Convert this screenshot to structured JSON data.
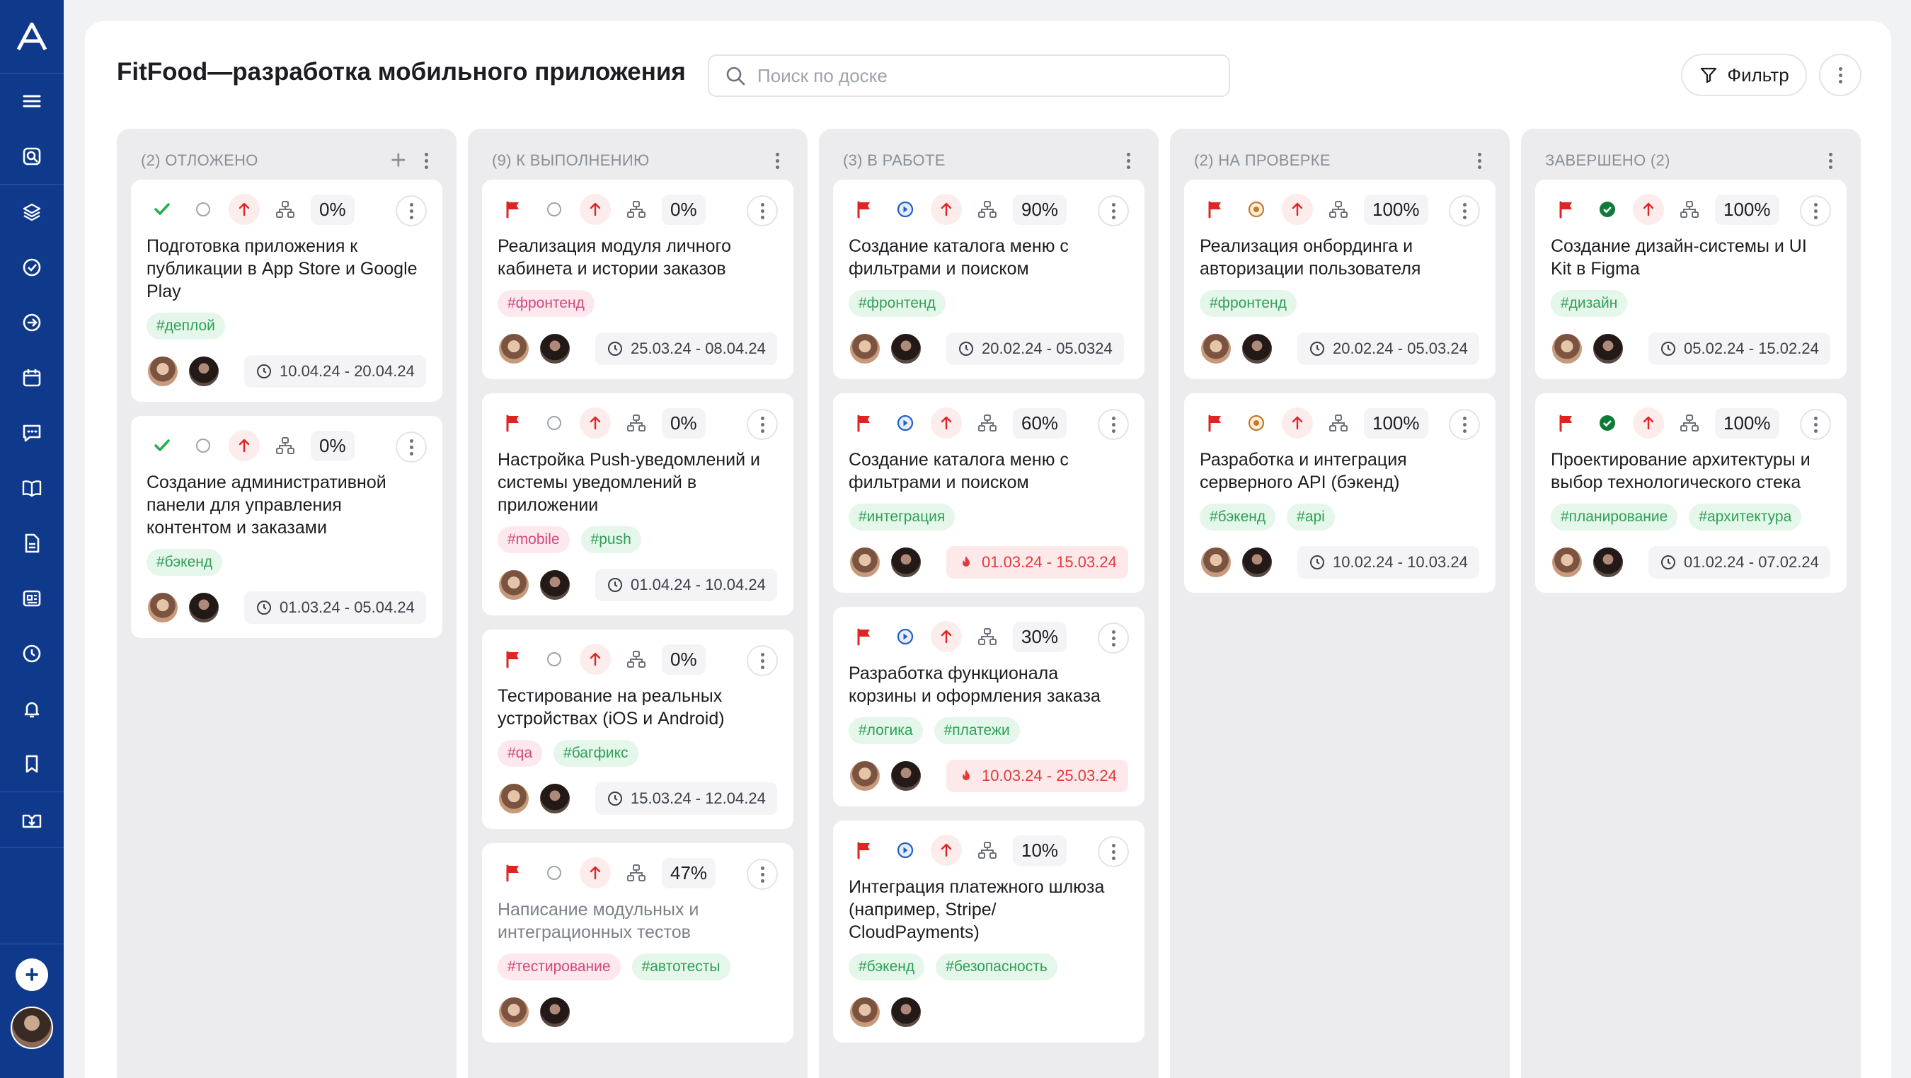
{
  "board": {
    "title": "FitFood—разработка мобильного приложения",
    "search_placeholder": "Поиск по доске",
    "filter_label": "Фильтр"
  },
  "colors": {
    "sidebar": "#0f3a8c",
    "flag": "#e02424",
    "check": "#22b04b",
    "tag_green": "#2fa156",
    "tag_pink": "#d2487a",
    "overdue": "#e03a3a"
  },
  "columns": [
    {
      "title": "(2) ОТЛОЖЕНО",
      "has_add": true,
      "cards": [
        {
          "status_icon": "check-icon",
          "state_icon": "empty-circle-icon",
          "progress": "0%",
          "title": "Подготовка приложения к публикации в App Store и Google Play",
          "tags": [
            {
              "text": "#деплой",
              "color": "green"
            }
          ],
          "dates": "10.04.24 - 20.04.24",
          "overdue": false
        },
        {
          "status_icon": "check-icon",
          "state_icon": "empty-circle-icon",
          "progress": "0%",
          "title": "Создание административной панели для управления контентом и заказами",
          "tags": [
            {
              "text": "#бэкенд",
              "color": "green"
            }
          ],
          "dates": "01.03.24 - 05.04.24",
          "overdue": false
        }
      ]
    },
    {
      "title": "(9) К ВЫПОЛНЕНИЮ",
      "has_add": false,
      "cards": [
        {
          "status_icon": "flag-icon",
          "state_icon": "empty-circle-icon",
          "progress": "0%",
          "title": "Реализация модуля личного кабинета и истории заказов",
          "tags": [
            {
              "text": "#фронтенд",
              "color": "pink"
            }
          ],
          "dates": "25.03.24 - 08.04.24",
          "overdue": false
        },
        {
          "status_icon": "flag-icon",
          "state_icon": "empty-circle-icon",
          "progress": "0%",
          "title": "Настройка Push-уведомлений и системы уведомлений в приложении",
          "tags": [
            {
              "text": "#mobile",
              "color": "pink"
            },
            {
              "text": "#push",
              "color": "green"
            }
          ],
          "dates": "01.04.24 - 10.04.24",
          "overdue": false
        },
        {
          "status_icon": "flag-icon",
          "state_icon": "empty-circle-icon",
          "progress": "0%",
          "title": "Тестирование на реальных устройствах (iOS и Android)",
          "tags": [
            {
              "text": "#qa",
              "color": "pink"
            },
            {
              "text": "#багфикс",
              "color": "green"
            }
          ],
          "dates": "15.03.24 - 12.04.24",
          "overdue": false
        },
        {
          "status_icon": "flag-icon",
          "state_icon": "empty-circle-icon",
          "progress": "47%",
          "title": "Написание модульных и интеграционных тестов",
          "muted": true,
          "tags": [
            {
              "text": "#тестирование",
              "color": "pink"
            },
            {
              "text": "#автотесты",
              "color": "green"
            }
          ],
          "dates": "",
          "overdue": false
        }
      ]
    },
    {
      "title": "(3) В РАБОТЕ",
      "has_add": false,
      "cards": [
        {
          "status_icon": "flag-icon",
          "state_icon": "play-circle-icon",
          "progress": "90%",
          "title": "Создание каталога меню с фильтрами и поиском",
          "tags": [
            {
              "text": "#фронтенд",
              "color": "green"
            }
          ],
          "dates": "20.02.24 - 05.0324",
          "overdue": false
        },
        {
          "status_icon": "flag-icon",
          "state_icon": "play-circle-icon",
          "progress": "60%",
          "title": "Создание каталога меню с фильтрами и поиском",
          "tags": [
            {
              "text": "#интеграция",
              "color": "green"
            }
          ],
          "dates": "01.03.24 - 15.03.24",
          "overdue": true
        },
        {
          "status_icon": "flag-icon",
          "state_icon": "play-circle-icon",
          "progress": "30%",
          "title": "Разработка функционала корзины и оформления заказа",
          "tags": [
            {
              "text": "#логика",
              "color": "green"
            },
            {
              "text": "#платежи",
              "color": "green"
            }
          ],
          "dates": "10.03.24 - 25.03.24",
          "overdue": true
        },
        {
          "status_icon": "flag-icon",
          "state_icon": "play-circle-icon",
          "progress": "10%",
          "title": "Интеграция платежного шлюза (например, Stripe/ CloudPayments)",
          "tags": [
            {
              "text": "#бэкенд",
              "color": "green"
            },
            {
              "text": "#безопасность",
              "color": "green"
            }
          ],
          "dates": "",
          "overdue": false
        }
      ]
    },
    {
      "title": "(2) НА ПРОВЕРКЕ",
      "has_add": false,
      "cards": [
        {
          "status_icon": "flag-icon",
          "state_icon": "review-circle-icon",
          "progress": "100%",
          "title": "Реализация онбординга и авторизации пользователя",
          "tags": [
            {
              "text": "#фронтенд",
              "color": "green"
            }
          ],
          "dates": "20.02.24 - 05.03.24",
          "overdue": false
        },
        {
          "status_icon": "flag-icon",
          "state_icon": "review-circle-icon",
          "progress": "100%",
          "title": "Разработка и интеграция серверного API (бэкенд)",
          "tags": [
            {
              "text": "#бэкенд",
              "color": "green"
            },
            {
              "text": "#api",
              "color": "green"
            }
          ],
          "dates": "10.02.24 - 10.03.24",
          "overdue": false
        }
      ]
    },
    {
      "title": "ЗАВЕРШЕНО (2)",
      "has_add": false,
      "cards": [
        {
          "status_icon": "flag-icon",
          "state_icon": "done-circle-icon",
          "progress": "100%",
          "title": "Создание дизайн-системы и UI Kit в Figma",
          "tags": [
            {
              "text": "#дизайн",
              "color": "green"
            }
          ],
          "dates": "05.02.24 - 15.02.24",
          "overdue": false
        },
        {
          "status_icon": "flag-icon",
          "state_icon": "done-circle-icon",
          "progress": "100%",
          "title": "Проектирование архитектуры и выбор технологического стека",
          "tags": [
            {
              "text": "#планирование",
              "color": "green"
            },
            {
              "text": "#архитектура",
              "color": "green"
            }
          ],
          "dates": "01.02.24 - 07.02.24",
          "overdue": false
        }
      ]
    }
  ]
}
